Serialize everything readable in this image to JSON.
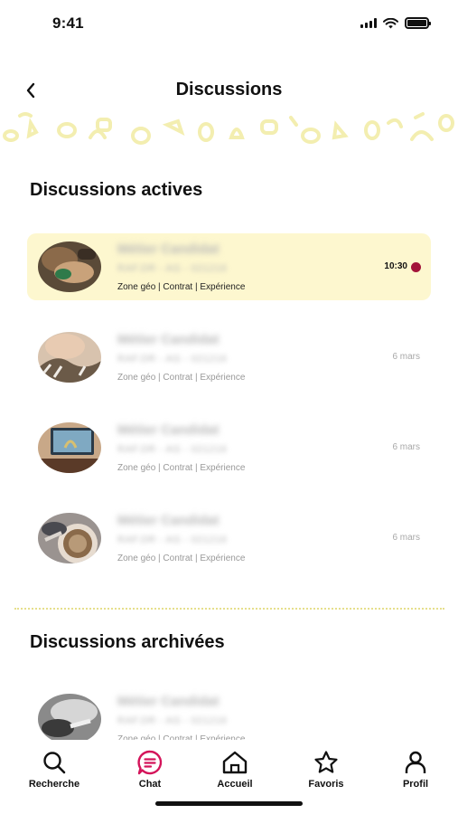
{
  "status": {
    "time": "9:41"
  },
  "header": {
    "title": "Discussions"
  },
  "sections": {
    "active_title": "Discussions actives",
    "archived_title": "Discussions archivées"
  },
  "conversations": [
    {
      "name": "Métier Candidat",
      "ref": "RAF.DR - AG - 021216",
      "tags": "Zone géo | Contrat | Expérience",
      "time": "10:30",
      "unread": true
    },
    {
      "name": "Métier Candidat",
      "ref": "RAF.DR - AG - 021216",
      "tags": "Zone géo | Contrat | Expérience",
      "time": "6 mars",
      "unread": false
    },
    {
      "name": "Métier Candidat",
      "ref": "RAF.DR - AG - 021216",
      "tags": "Zone géo | Contrat | Expérience",
      "time": "6 mars",
      "unread": false
    },
    {
      "name": "Métier Candidat",
      "ref": "RAF.DR - AG - 021216",
      "tags": "Zone géo | Contrat | Expérience",
      "time": "6 mars",
      "unread": false
    }
  ],
  "archived": [
    {
      "name": "Métier Candidat",
      "ref": "RAF.DR - AG - 021216",
      "tags": "Zone géo | Contrat | Expérience"
    }
  ],
  "tabbar": {
    "items": [
      {
        "label": "Recherche",
        "icon": "search-icon"
      },
      {
        "label": "Chat",
        "icon": "chat-icon",
        "selected": true
      },
      {
        "label": "Accueil",
        "icon": "home-icon"
      },
      {
        "label": "Favoris",
        "icon": "star-icon"
      },
      {
        "label": "Profil",
        "icon": "profile-icon"
      }
    ]
  },
  "colors": {
    "accent": "#d4145a",
    "active_row_bg": "#fdf7cf",
    "unread_dot": "#a3143a",
    "pattern": "#f3eeb0"
  }
}
